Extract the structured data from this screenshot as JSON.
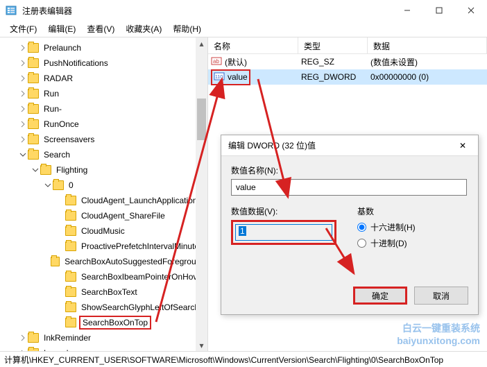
{
  "window": {
    "title": "注册表编辑器",
    "min": "–",
    "max": "□",
    "close": "✕"
  },
  "menu": {
    "file": "文件(F)",
    "edit": "编辑(E)",
    "view": "查看(V)",
    "fav": "收藏夹(A)",
    "help": "帮助(H)"
  },
  "tree": {
    "items": [
      {
        "depth": 1,
        "chev": ">",
        "label": "Prelaunch"
      },
      {
        "depth": 1,
        "chev": ">",
        "label": "PushNotifications"
      },
      {
        "depth": 1,
        "chev": ">",
        "label": "RADAR"
      },
      {
        "depth": 1,
        "chev": ">",
        "label": "Run"
      },
      {
        "depth": 1,
        "chev": ">",
        "label": "Run-"
      },
      {
        "depth": 1,
        "chev": ">",
        "label": "RunOnce"
      },
      {
        "depth": 1,
        "chev": ">",
        "label": "Screensavers"
      },
      {
        "depth": 1,
        "chev": "v",
        "label": "Search"
      },
      {
        "depth": 2,
        "chev": "v",
        "label": "Flighting"
      },
      {
        "depth": 3,
        "chev": "v",
        "label": "0"
      },
      {
        "depth": 4,
        "chev": "",
        "label": "CloudAgent_LaunchApplication"
      },
      {
        "depth": 4,
        "chev": "",
        "label": "CloudAgent_ShareFile"
      },
      {
        "depth": 4,
        "chev": "",
        "label": "CloudMusic"
      },
      {
        "depth": 4,
        "chev": "",
        "label": "ProactivePrefetchIntervalMinutes"
      },
      {
        "depth": 4,
        "chev": "",
        "label": "SearchBoxAutoSuggestedForeground"
      },
      {
        "depth": 4,
        "chev": "",
        "label": "SearchBoxIbeamPointerOnHover"
      },
      {
        "depth": 4,
        "chev": "",
        "label": "SearchBoxText"
      },
      {
        "depth": 4,
        "chev": "",
        "label": "ShowSearchGlyphLeftOfSearch"
      },
      {
        "depth": 4,
        "chev": "",
        "label": "SearchBoxOnTop",
        "sel": true
      },
      {
        "depth": 1,
        "chev": ">",
        "label": "InkReminder"
      },
      {
        "depth": 1,
        "chev": ">",
        "label": "Launch"
      }
    ]
  },
  "list": {
    "cols": {
      "name": "名称",
      "type": "类型",
      "data": "数据"
    },
    "rows": [
      {
        "icon": "str",
        "name": "(默认)",
        "type": "REG_SZ",
        "data": "(数值未设置)"
      },
      {
        "icon": "dw",
        "name": "value",
        "type": "REG_DWORD",
        "data": "0x00000000 (0)",
        "sel": true,
        "boxed": true
      }
    ]
  },
  "dialog": {
    "title": "编辑 DWORD (32 位)值",
    "close": "✕",
    "name_label": "数值名称(N):",
    "name_value": "value",
    "data_label": "数值数据(V):",
    "data_value": "1",
    "radix_label": "基数",
    "hex": "十六进制(H)",
    "dec": "十进制(D)",
    "ok": "确定",
    "cancel": "取消"
  },
  "statusbar": "计算机\\HKEY_CURRENT_USER\\SOFTWARE\\Microsoft\\Windows\\CurrentVersion\\Search\\Flighting\\0\\SearchBoxOnTop",
  "watermark": "白云一键重装系统\nbaiyunxitong.com"
}
